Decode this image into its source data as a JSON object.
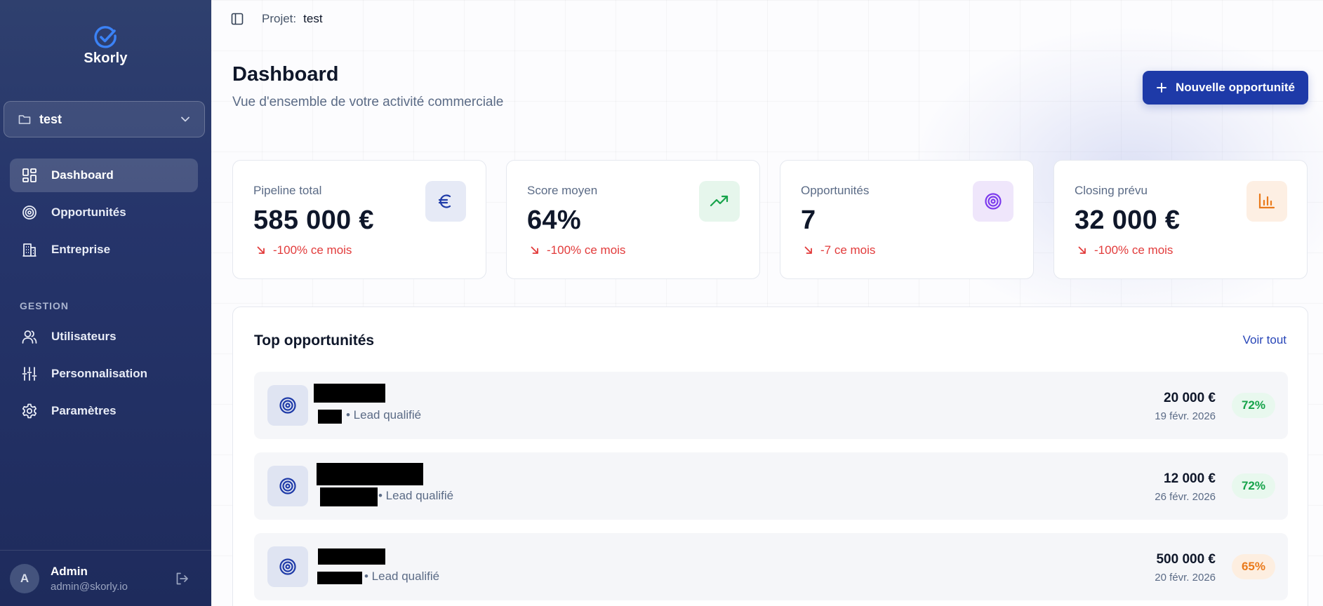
{
  "sidebar": {
    "logo_text": "Skorly",
    "project_select": {
      "value": "test"
    },
    "nav": [
      {
        "label": "Dashboard",
        "icon": "grid-icon",
        "active": true
      },
      {
        "label": "Opportunités",
        "icon": "target-icon"
      },
      {
        "label": "Entreprise",
        "icon": "building-icon"
      }
    ],
    "section_label": "GESTION",
    "gestion": [
      {
        "label": "Utilisateurs",
        "icon": "users-icon"
      },
      {
        "label": "Personnalisation",
        "icon": "sliders-icon"
      },
      {
        "label": "Paramètres",
        "icon": "gear-icon"
      }
    ],
    "user": {
      "initial": "A",
      "name": "Admin",
      "email": "admin@skorly.io"
    }
  },
  "topbar": {
    "project_label": "Projet:",
    "project_name": "test"
  },
  "header": {
    "title": "Dashboard",
    "subtitle": "Vue d'ensemble de votre activité commerciale",
    "new_button_label": "Nouvelle opportunité"
  },
  "stats": [
    {
      "label": "Pipeline total",
      "value": "585 000 €",
      "trend": "-100% ce mois",
      "icon": "euro-icon",
      "icon_bg": "#e6eaf6",
      "icon_color": "#1e3aa8"
    },
    {
      "label": "Score moyen",
      "value": "64%",
      "trend": "-100% ce mois",
      "icon": "trending-up-icon",
      "icon_bg": "#e6f6ec",
      "icon_color": "#16a34a"
    },
    {
      "label": "Opportunités",
      "value": "7",
      "trend": "-7 ce mois",
      "icon": "target-icon",
      "icon_bg": "#efe6fb",
      "icon_color": "#7c3aed"
    },
    {
      "label": "Closing prévu",
      "value": "32 000 €",
      "trend": "-100% ce mois",
      "icon": "bar-chart-icon",
      "icon_bg": "#fdefe3",
      "icon_color": "#ea7a1b"
    }
  ],
  "top_opportunities": {
    "title": "Top opportunités",
    "see_all": "Voir tout",
    "rows": [
      {
        "stage": "• Lead qualifié",
        "amount": "20 000 €",
        "date": "19 févr. 2026",
        "score": "72%",
        "score_color": "green"
      },
      {
        "stage": "• Lead qualifié",
        "amount": "12 000 €",
        "date": "26 févr. 2026",
        "score": "72%",
        "score_color": "green"
      },
      {
        "stage": "• Lead qualifié",
        "amount": "500 000 €",
        "date": "20 févr. 2026",
        "score": "65%",
        "score_color": "orange"
      }
    ]
  },
  "colors": {
    "sidebar_bg": "#26356b",
    "accent": "#1e3aa8",
    "trend_negative": "#e23b3b"
  }
}
